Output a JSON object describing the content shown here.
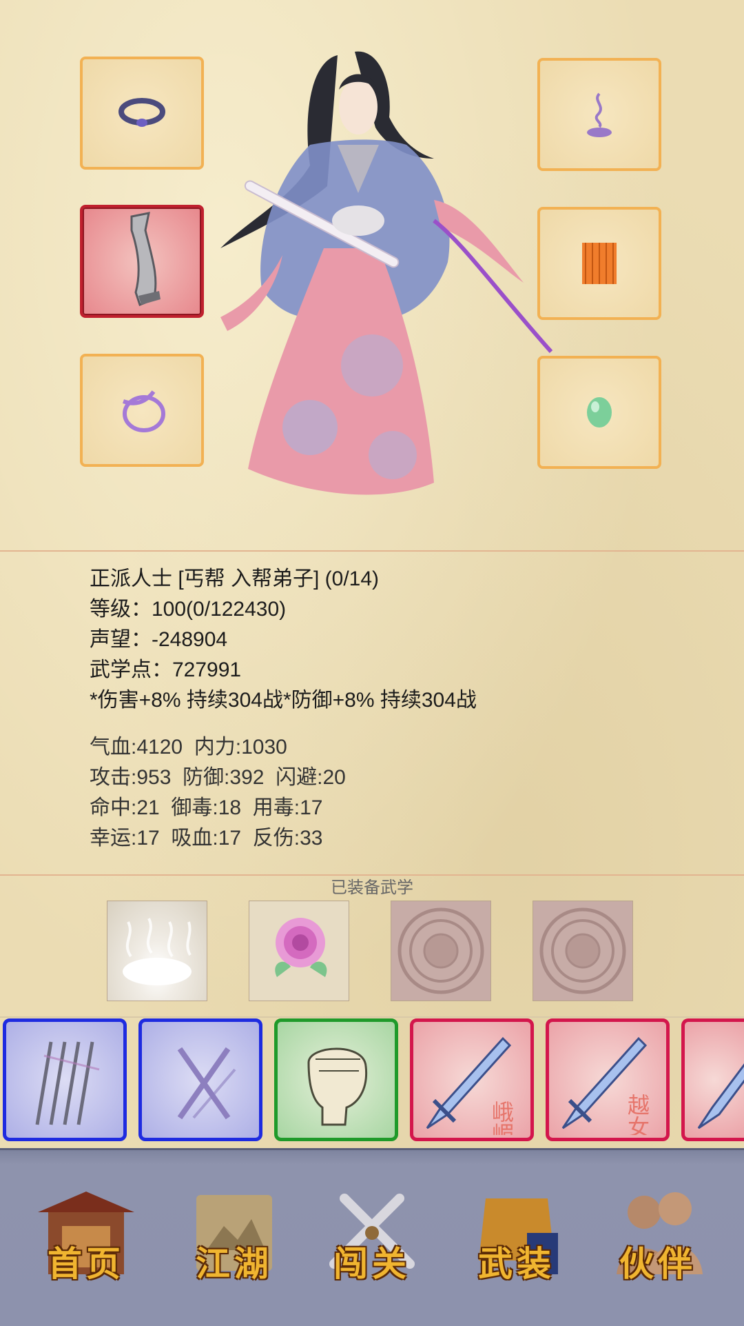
{
  "equipment": {
    "left_slots": [
      "ring-icon",
      "broadsword-icon",
      "bracelet-icon"
    ],
    "right_slots": [
      "incense-icon",
      "armor-skirt-icon",
      "jade-icon"
    ]
  },
  "profile": {
    "faction_line": "正派人士 [丐帮 入帮弟子] (0/14)",
    "level_line": "等级：100(0/122430)",
    "reputation_line": "声望：-248904",
    "martial_points_line": "武学点：727991",
    "buff_line": "*伤害+8% 持续304战*防御+8% 持续304战"
  },
  "attributes": {
    "line1": "气血:4120  内力:1030",
    "line2": "攻击:953  防御:392  闪避:20",
    "line3": "命中:21  御毒:18  用毒:17",
    "line4": "幸运:17  吸血:17  反伤:33"
  },
  "equipped_skills": {
    "title": "已装备武学",
    "slots": [
      "mist-skill",
      "peony-skill",
      "empty-seal",
      "empty-seal"
    ]
  },
  "skill_cards": [
    {
      "type": "slash-claw",
      "color": "blue"
    },
    {
      "type": "cross-sticks",
      "color": "blue"
    },
    {
      "type": "fist",
      "color": "green"
    },
    {
      "type": "sword",
      "color": "red",
      "label": "峨嵋"
    },
    {
      "type": "sword",
      "color": "red",
      "label": "越女"
    },
    {
      "type": "sword",
      "color": "red"
    }
  ],
  "nav": {
    "home": "首页",
    "jianghu": "江湖",
    "challenge": "闯关",
    "equip": "武装",
    "partner": "伙伴"
  },
  "colors": {
    "slot_border": "#f2b153",
    "slot_active": "#c0202e",
    "nav_text": "#f0b530",
    "nav_bg": "#8d92ad"
  }
}
